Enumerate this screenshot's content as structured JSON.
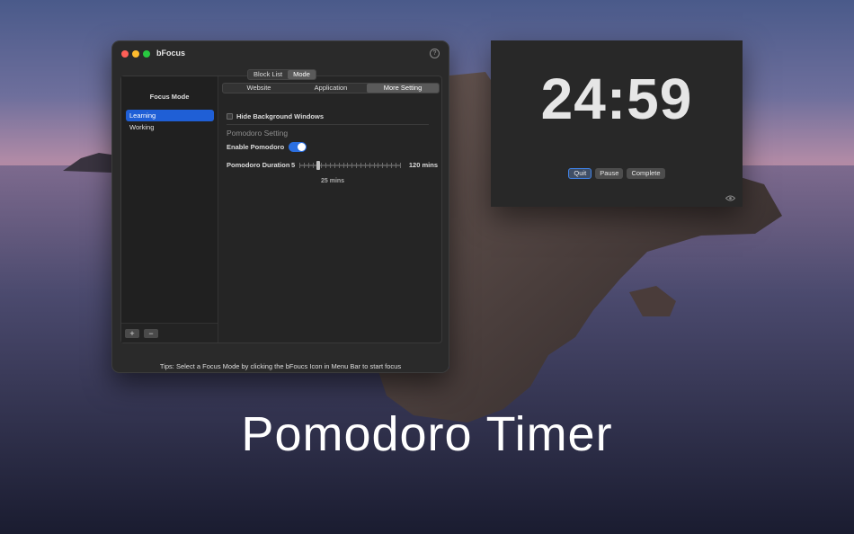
{
  "window": {
    "title": "bFocus",
    "help_glyph": "?",
    "top_tabs": [
      {
        "label": "Block List",
        "active": false
      },
      {
        "label": "Mode",
        "active": true
      }
    ],
    "sidebar": {
      "title": "Focus Mode",
      "items": [
        {
          "label": "Learning",
          "selected": true
        },
        {
          "label": "Working",
          "selected": false
        }
      ],
      "add_label": "+",
      "remove_label": "−"
    },
    "sub_tabs": [
      {
        "label": "Website",
        "active": false
      },
      {
        "label": "Application",
        "active": false
      },
      {
        "label": "More Setting",
        "active": true
      }
    ],
    "hide_bg": {
      "label": "Hide Background Windows",
      "checked": false
    },
    "pomodoro": {
      "section_title": "Pomodoro Setting",
      "enable_label": "Enable Pomodoro",
      "enabled": true,
      "duration_label": "Pomodoro Duration",
      "min_label": "5",
      "max_label": "120 mins",
      "min": 5,
      "max": 120,
      "value": 25,
      "value_label": "25 mins"
    },
    "tips": "Tips: Select a Focus Mode by clicking the bFoucs Icon in Menu Bar to start focus"
  },
  "timer": {
    "time": "24:59",
    "buttons": {
      "quit": "Quit",
      "pause": "Pause",
      "complete": "Complete"
    },
    "eye_icon": "eye-icon"
  },
  "caption": "Pomodoro Timer",
  "colors": {
    "accent": "#1f5fd6",
    "toggle": "#2b6fe0",
    "window_bg": "#2a2a2a"
  }
}
